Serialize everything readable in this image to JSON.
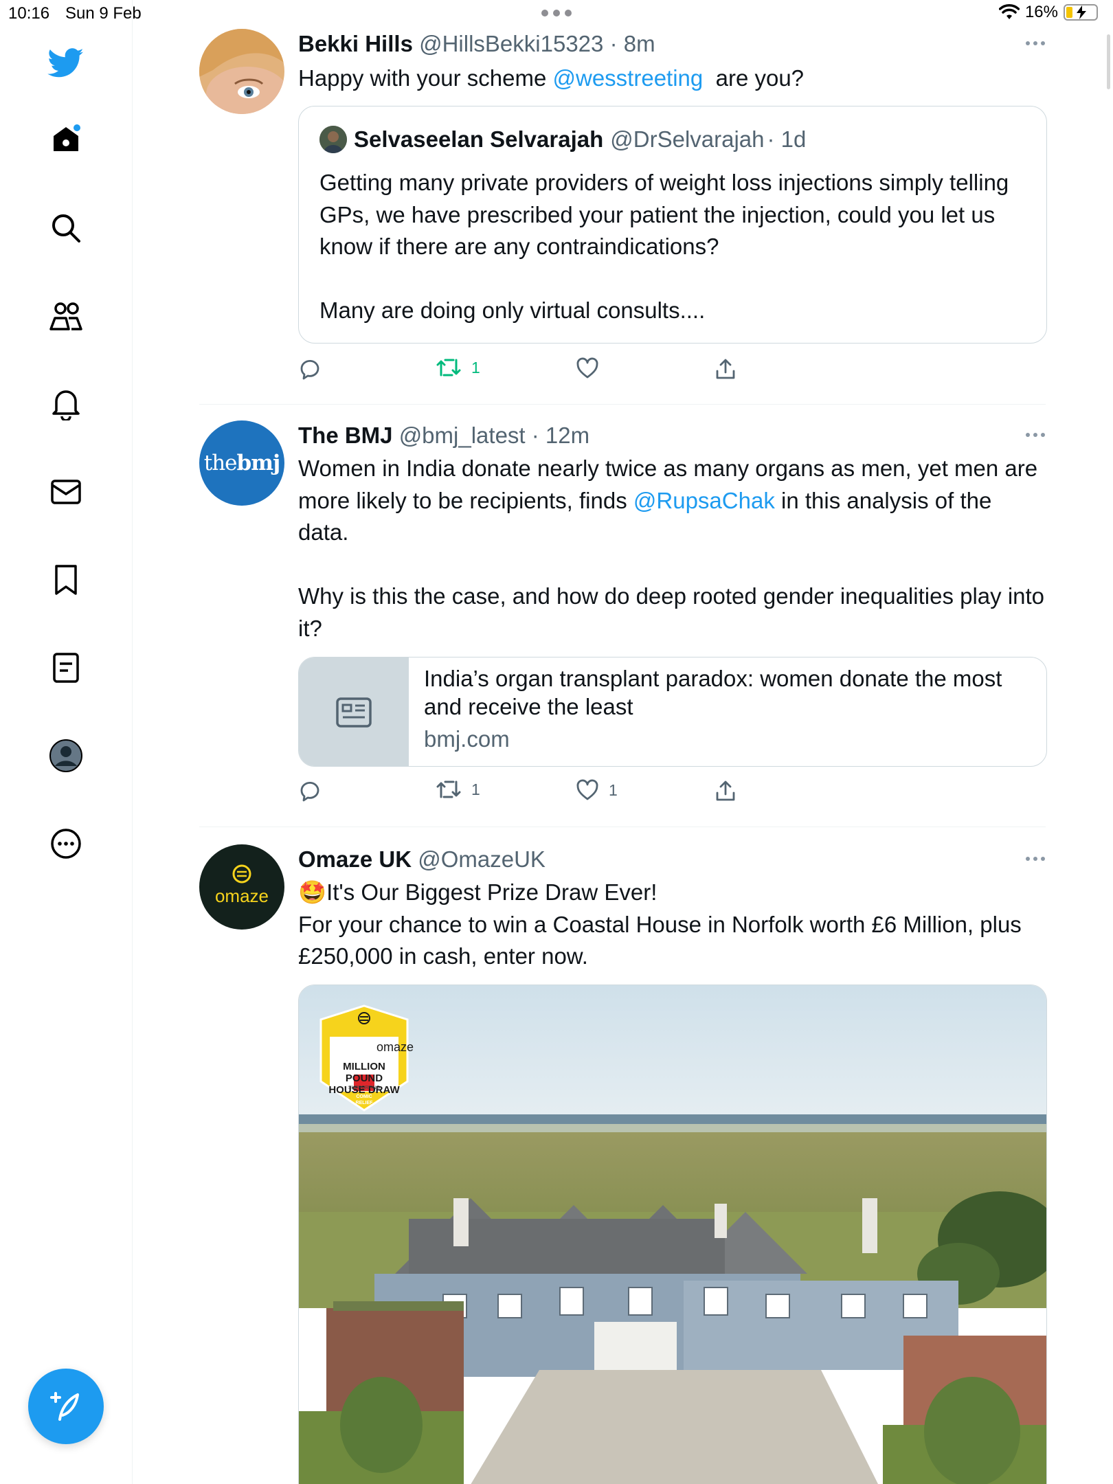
{
  "status_bar": {
    "time": "10:16",
    "date": "Sun 9 Feb",
    "battery": "16%"
  },
  "sidebar": {
    "items": [
      "Home",
      "Search",
      "Communities",
      "Notifications",
      "Messages",
      "Bookmarks",
      "Lists",
      "Profile",
      "More"
    ],
    "compose_label": "Tweet"
  },
  "tweets": [
    {
      "name": "Bekki Hills",
      "handle": "@HillsBekki15323",
      "time": "· 8m",
      "text_before": "Happy with your scheme ",
      "mention": "@wesstreeting",
      "text_after": "  are you?",
      "quote": {
        "name": "Selvaseelan Selvarajah",
        "handle": "@DrSelvarajah",
        "time": "· 1d",
        "text": "Getting many private providers of weight loss injections simply telling GPs, we have prescribed your patient the injection, could you let us know if there are any contraindications?\n\nMany are doing only virtual consults...."
      },
      "retweets": "1",
      "likes": ""
    },
    {
      "name": "The BMJ",
      "handle": "@bmj_latest",
      "time": "· 12m",
      "avatar_text_a": "the",
      "avatar_text_b": "bmj",
      "text_before": "Women in India donate nearly twice as many organs as men, yet men are more likely to be recipients, finds ",
      "mention": "@RupsaChak",
      "text_after": " in this analysis of the data.\n\nWhy is this the case, and how do deep rooted gender inequalities play into it?",
      "card": {
        "title": "India’s organ transplant paradox: women donate the most and receive the least",
        "domain": "bmj.com"
      },
      "retweets": "1",
      "likes": "1"
    },
    {
      "name": "Omaze UK",
      "handle": "@OmazeUK",
      "avatar_text": "omaze",
      "emoji": "🤩",
      "line1": "It's Our Biggest Prize Draw Ever!",
      "line2": "For your chance to win a Coastal House in Norfolk worth £6 Million, plus £250,000 in cash, enter now.",
      "badge": {
        "brand": "omaze",
        "line1": "MILLION POUND",
        "line2": "HOUSE DRAW",
        "supporting": "SUPPORTING",
        "charity": "COMIC RELIEF"
      }
    }
  ],
  "colors": {
    "accent": "#1d9bf0",
    "retweet_active": "#00ba7c",
    "bmj_blue": "#1e73be",
    "omaze_yellow": "#f6d31c"
  }
}
